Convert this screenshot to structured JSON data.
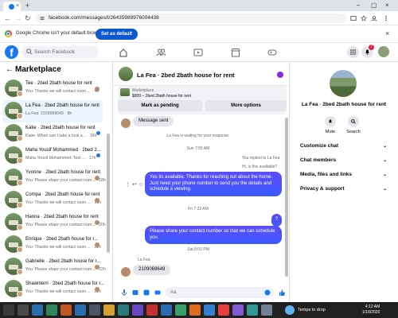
{
  "browser": {
    "url": "facebook.com/messages/t/26435989976004438",
    "infobar_message": "Google Chrome isn't your default browser",
    "set_default_label": "Set as default"
  },
  "facebook": {
    "search_placeholder": "Search Facebook",
    "notification_count": "7"
  },
  "marketplace": {
    "title": "Marketplace",
    "conversations": [
      {
        "name": "Tee · 2bed 2bath house for rent",
        "preview": "You: Thanks we will contact soon ... · 4h",
        "indicator": "avatar"
      },
      {
        "name": "La Fea · 2bed 2bath house for rent",
        "preview": "La Fea: 2109069649 · 8h",
        "indicator": "none",
        "selected": true
      },
      {
        "name": "Katie · 2bed 2bath house for rent",
        "preview": "Katie: When can I take a look a... · 16h",
        "indicator": "dot"
      },
      {
        "name": "Maha Yousif Mohammed · 2bed 2...",
        "preview": "Maha Yousif Mohammed: Text ... · 17h",
        "indicator": "dot"
      },
      {
        "name": "Yvonne · 2bed 2bath house for rent",
        "preview": "You: Please share your contact num... · 18h",
        "indicator": "avatar"
      },
      {
        "name": "Compa · 2bed 2bath house for rent",
        "preview": "You: Thanks we will contact soon ... · 19h",
        "indicator": "avatar"
      },
      {
        "name": "Hanna · 2bed 2bath house for rent",
        "preview": "You: Please share your contact num... · 20h",
        "indicator": "avatar"
      },
      {
        "name": "Enrique · 2bed 2bath house for r...",
        "preview": "You: Thanks we will contact soon ... · 22h",
        "indicator": "avatar"
      },
      {
        "name": "Gabrielle · 2bed 2bath house for r...",
        "preview": "You: Please share your contact num... · 22h",
        "indicator": "avatar"
      },
      {
        "name": "Shawnterri · 2bed 2bath house for r...",
        "preview": "You: Thanks we will contact soon ... · 22h",
        "indicator": "avatar"
      }
    ]
  },
  "chat": {
    "title": "La Fea · 2bed 2bath house for rent",
    "listing_label": "Marketplace",
    "listing_detail": "$900 – 2bed 2bath house for rent",
    "mark_pending_label": "Mark as pending",
    "more_options_label": "More options",
    "messages": {
      "sent_notice": "Message sent",
      "waiting_notice": "La Fea is waiting for your response.",
      "time1": "Sun 7:55 AM",
      "replied_to": "You replied to La Fea",
      "quoted": "Hi, is this available?",
      "reply1": "Yes its available. Thanks for reaching out about the home. Just need your phone number to send you the details and schedule a viewing.",
      "time2": "Fri 7:33 AM",
      "question": "?",
      "reply2": "Please share your contact number so that we can schedule you.",
      "time3": "Sat 8:01 PM",
      "sender_name": "La Fea",
      "phone": "2109069649"
    },
    "composer_placeholder": "Aa"
  },
  "details": {
    "name": "La Fea · 2bed 2bath house for rent",
    "mute_label": "Mute",
    "search_label": "Search",
    "sections": [
      "Customize chat",
      "Chat members",
      "Media, files and links",
      "Privacy & support"
    ]
  },
  "taskbar": {
    "weather": "Temps to drop",
    "time": "4:12 AM",
    "date": "1/18/2026"
  }
}
